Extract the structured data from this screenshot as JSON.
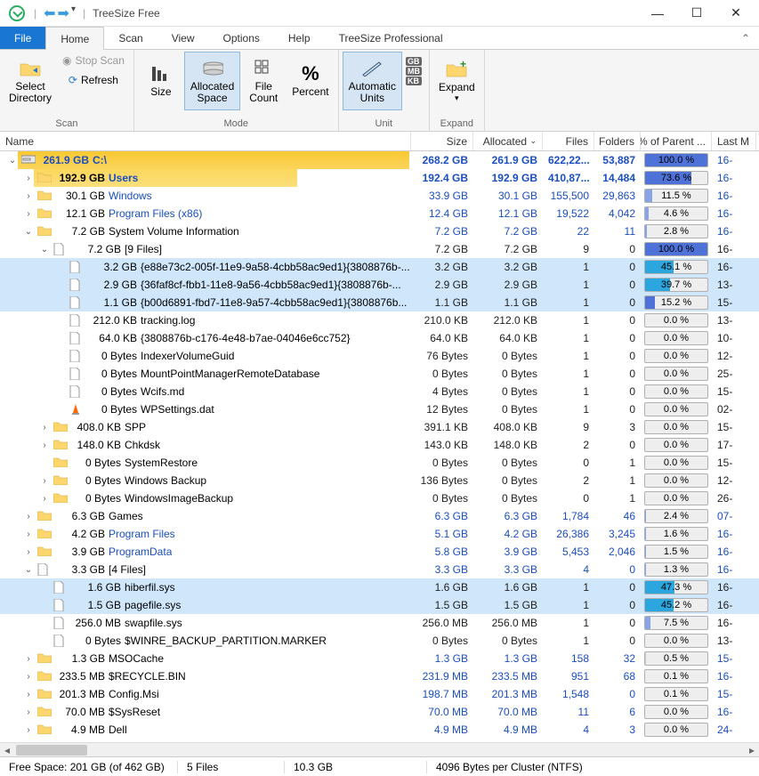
{
  "app": {
    "title": "TreeSize Free"
  },
  "tabs": {
    "file": "File",
    "home": "Home",
    "scan": "Scan",
    "view": "View",
    "options": "Options",
    "help": "Help",
    "pro": "TreeSize Professional"
  },
  "ribbon": {
    "scan": {
      "label": "Scan",
      "select_dir": "Select\nDirectory",
      "stop": "Stop Scan",
      "refresh": "Refresh"
    },
    "mode": {
      "label": "Mode",
      "size": "Size",
      "alloc": "Allocated\nSpace",
      "filecount": "File\nCount",
      "percent": "Percent"
    },
    "unit": {
      "label": "Unit",
      "auto": "Automatic\nUnits",
      "gb": "GB",
      "mb": "MB",
      "kb": "KB"
    },
    "expand": {
      "label": "Expand",
      "expand": "Expand"
    }
  },
  "columns": {
    "name": "Name",
    "size": "Size",
    "alloc": "Allocated",
    "files": "Files",
    "folders": "Folders",
    "pct": "% of Parent ...",
    "lastm": "Last M"
  },
  "widths": {
    "name": 462,
    "size": 70,
    "alloc": 78,
    "files": 58,
    "folders": 52,
    "pct": 80,
    "lastm": 50
  },
  "colors": {
    "bar_root": "#f9c932",
    "bar_users": "#fbd75b",
    "bar_blue": "#4f72d8",
    "bar_blue_light": "#8aa4e8",
    "bar_cyan": "#2ba6de"
  },
  "rows": [
    {
      "d": 0,
      "exp": "open",
      "kind": "drive",
      "sizew": 440,
      "barc": "bar_root",
      "sz": "261.9 GB",
      "nm": "C:\\",
      "link": false,
      "size": "268.2 GB",
      "alloc": "261.9 GB",
      "files": "622,22...",
      "fold": "53,887",
      "pct": "100.0 %",
      "pctw": 100,
      "pctc": "#4f72d8",
      "lm": "16-"
    },
    {
      "d": 1,
      "exp": "closed",
      "kind": "folder",
      "sizew": 296,
      "barc": "bar_users",
      "sz": "192.9 GB",
      "nm": "Users",
      "link": true,
      "bold": true,
      "size": "192.4 GB",
      "alloc": "192.9 GB",
      "files": "410,87...",
      "fold": "14,484",
      "pct": "73.6 %",
      "pctw": 74,
      "pctc": "#4f72d8",
      "lm": "16-"
    },
    {
      "d": 1,
      "exp": "closed",
      "kind": "folder",
      "sizew": 0,
      "sz": "30.1 GB",
      "nm": "Windows",
      "link": true,
      "size": "33.9 GB",
      "alloc": "30.1 GB",
      "files": "155,500",
      "fold": "29,863",
      "pct": "11.5 %",
      "pctw": 12,
      "pctc": "#8aa4e8",
      "lm": "16-"
    },
    {
      "d": 1,
      "exp": "closed",
      "kind": "folder",
      "sizew": 0,
      "sz": "12.1 GB",
      "nm": "Program Files (x86)",
      "link": true,
      "size": "12.4 GB",
      "alloc": "12.1 GB",
      "files": "19,522",
      "fold": "4,042",
      "pct": "4.6 %",
      "pctw": 5,
      "pctc": "#8aa4e8",
      "lm": "16-"
    },
    {
      "d": 1,
      "exp": "open",
      "kind": "folder",
      "sizew": 0,
      "sz": "7.2 GB",
      "nm": "System Volume Information",
      "link": false,
      "size": "7.2 GB",
      "alloc": "7.2 GB",
      "files": "22",
      "fold": "11",
      "pct": "2.8 %",
      "pctw": 3,
      "pctc": "#8aa4e8",
      "lm": "16-"
    },
    {
      "d": 2,
      "exp": "open",
      "kind": "file",
      "sizew": 0,
      "sz": "7.2 GB",
      "nm": "[9 Files]",
      "link": false,
      "size": "7.2 GB",
      "alloc": "7.2 GB",
      "files": "9",
      "fold": "0",
      "pct": "100.0 %",
      "pctw": 100,
      "pctc": "#4f72d8",
      "lm": "16-"
    },
    {
      "d": 3,
      "exp": "",
      "kind": "file",
      "sel": true,
      "sizew": 0,
      "sz": "3.2 GB",
      "nm": "{e88e73c2-005f-11e9-9a58-4cbb58ac9ed1}{3808876b-...",
      "link": false,
      "size": "3.2 GB",
      "alloc": "3.2 GB",
      "files": "1",
      "fold": "0",
      "pct": "45.1 %",
      "pctw": 45,
      "pctc": "#2ba6de",
      "lm": "16-"
    },
    {
      "d": 3,
      "exp": "",
      "kind": "file",
      "sel": true,
      "sizew": 0,
      "sz": "2.9 GB",
      "nm": "{36faf8cf-fbb1-11e8-9a56-4cbb58ac9ed1}{3808876b-...",
      "link": false,
      "size": "2.9 GB",
      "alloc": "2.9 GB",
      "files": "1",
      "fold": "0",
      "pct": "39.7 %",
      "pctw": 40,
      "pctc": "#2ba6de",
      "lm": "13-"
    },
    {
      "d": 3,
      "exp": "",
      "kind": "file",
      "sel": true,
      "sizew": 0,
      "sz": "1.1 GB",
      "nm": "{b00d6891-fbd7-11e8-9a57-4cbb58ac9ed1}{3808876b...",
      "link": false,
      "size": "1.1 GB",
      "alloc": "1.1 GB",
      "files": "1",
      "fold": "0",
      "pct": "15.2 %",
      "pctw": 15,
      "pctc": "#4f72d8",
      "lm": "15-"
    },
    {
      "d": 3,
      "exp": "",
      "kind": "file",
      "sizew": 0,
      "sz": "212.0 KB",
      "nm": "tracking.log",
      "link": false,
      "size": "210.0 KB",
      "alloc": "212.0 KB",
      "files": "1",
      "fold": "0",
      "pct": "0.0 %",
      "pctw": 0,
      "pctc": "#ccc",
      "lm": "13-"
    },
    {
      "d": 3,
      "exp": "",
      "kind": "file",
      "sizew": 0,
      "sz": "64.0 KB",
      "nm": "{3808876b-c176-4e48-b7ae-04046e6cc752}",
      "link": false,
      "size": "64.0 KB",
      "alloc": "64.0 KB",
      "files": "1",
      "fold": "0",
      "pct": "0.0 %",
      "pctw": 0,
      "pctc": "#ccc",
      "lm": "10-"
    },
    {
      "d": 3,
      "exp": "",
      "kind": "file",
      "sizew": 0,
      "sz": "0 Bytes",
      "nm": "IndexerVolumeGuid",
      "link": false,
      "size": "76 Bytes",
      "alloc": "0 Bytes",
      "files": "1",
      "fold": "0",
      "pct": "0.0 %",
      "pctw": 0,
      "pctc": "#ccc",
      "lm": "12-"
    },
    {
      "d": 3,
      "exp": "",
      "kind": "file",
      "sizew": 0,
      "sz": "0 Bytes",
      "nm": "MountPointManagerRemoteDatabase",
      "link": false,
      "size": "0 Bytes",
      "alloc": "0 Bytes",
      "files": "1",
      "fold": "0",
      "pct": "0.0 %",
      "pctw": 0,
      "pctc": "#ccc",
      "lm": "25-"
    },
    {
      "d": 3,
      "exp": "",
      "kind": "file",
      "sizew": 0,
      "sz": "0 Bytes",
      "nm": "Wcifs.md",
      "link": false,
      "size": "4 Bytes",
      "alloc": "0 Bytes",
      "files": "1",
      "fold": "0",
      "pct": "0.0 %",
      "pctw": 0,
      "pctc": "#ccc",
      "lm": "15-"
    },
    {
      "d": 3,
      "exp": "",
      "kind": "vlc",
      "sizew": 0,
      "sz": "0 Bytes",
      "nm": "WPSettings.dat",
      "link": false,
      "size": "12 Bytes",
      "alloc": "0 Bytes",
      "files": "1",
      "fold": "0",
      "pct": "0.0 %",
      "pctw": 0,
      "pctc": "#ccc",
      "lm": "02-"
    },
    {
      "d": 2,
      "exp": "closed",
      "kind": "folder",
      "sizew": 0,
      "sz": "408.0 KB",
      "nm": "SPP",
      "link": false,
      "size": "391.1 KB",
      "alloc": "408.0 KB",
      "files": "9",
      "fold": "3",
      "pct": "0.0 %",
      "pctw": 0,
      "pctc": "#ccc",
      "lm": "15-"
    },
    {
      "d": 2,
      "exp": "closed",
      "kind": "folder",
      "sizew": 0,
      "sz": "148.0 KB",
      "nm": "Chkdsk",
      "link": false,
      "size": "143.0 KB",
      "alloc": "148.0 KB",
      "files": "2",
      "fold": "0",
      "pct": "0.0 %",
      "pctw": 0,
      "pctc": "#ccc",
      "lm": "17-"
    },
    {
      "d": 2,
      "exp": "",
      "kind": "folder",
      "sizew": 0,
      "sz": "0 Bytes",
      "nm": "SystemRestore",
      "link": false,
      "size": "0 Bytes",
      "alloc": "0 Bytes",
      "files": "0",
      "fold": "1",
      "pct": "0.0 %",
      "pctw": 0,
      "pctc": "#ccc",
      "lm": "15-"
    },
    {
      "d": 2,
      "exp": "closed",
      "kind": "folder",
      "sizew": 0,
      "sz": "0 Bytes",
      "nm": "Windows Backup",
      "link": false,
      "size": "136 Bytes",
      "alloc": "0 Bytes",
      "files": "2",
      "fold": "1",
      "pct": "0.0 %",
      "pctw": 0,
      "pctc": "#ccc",
      "lm": "12-"
    },
    {
      "d": 2,
      "exp": "closed",
      "kind": "folder",
      "sizew": 0,
      "sz": "0 Bytes",
      "nm": "WindowsImageBackup",
      "link": false,
      "size": "0 Bytes",
      "alloc": "0 Bytes",
      "files": "0",
      "fold": "1",
      "pct": "0.0 %",
      "pctw": 0,
      "pctc": "#ccc",
      "lm": "26-"
    },
    {
      "d": 1,
      "exp": "closed",
      "kind": "folder",
      "sizew": 0,
      "sz": "6.3 GB",
      "nm": "Games",
      "link": false,
      "size": "6.3 GB",
      "alloc": "6.3 GB",
      "files": "1,784",
      "fold": "46",
      "pct": "2.4 %",
      "pctw": 2,
      "pctc": "#8aa4e8",
      "lm": "07-"
    },
    {
      "d": 1,
      "exp": "closed",
      "kind": "folder",
      "sizew": 0,
      "sz": "4.2 GB",
      "nm": "Program Files",
      "link": true,
      "size": "5.1 GB",
      "alloc": "4.2 GB",
      "files": "26,386",
      "fold": "3,245",
      "pct": "1.6 %",
      "pctw": 2,
      "pctc": "#8aa4e8",
      "lm": "16-"
    },
    {
      "d": 1,
      "exp": "closed",
      "kind": "folder",
      "sizew": 0,
      "sz": "3.9 GB",
      "nm": "ProgramData",
      "link": true,
      "size": "5.8 GB",
      "alloc": "3.9 GB",
      "files": "5,453",
      "fold": "2,046",
      "pct": "1.5 %",
      "pctw": 2,
      "pctc": "#8aa4e8",
      "lm": "16-"
    },
    {
      "d": 1,
      "exp": "open",
      "kind": "file",
      "sizew": 0,
      "sz": "3.3 GB",
      "nm": "[4 Files]",
      "link": false,
      "size": "3.3 GB",
      "alloc": "3.3 GB",
      "files": "4",
      "fold": "0",
      "pct": "1.3 %",
      "pctw": 1,
      "pctc": "#8aa4e8",
      "lm": "16-"
    },
    {
      "d": 2,
      "exp": "",
      "kind": "file",
      "sel": true,
      "sizew": 0,
      "sz": "1.6 GB",
      "nm": "hiberfil.sys",
      "link": false,
      "size": "1.6 GB",
      "alloc": "1.6 GB",
      "files": "1",
      "fold": "0",
      "pct": "47.3 %",
      "pctw": 47,
      "pctc": "#2ba6de",
      "lm": "16-"
    },
    {
      "d": 2,
      "exp": "",
      "kind": "file",
      "sel": true,
      "sizew": 0,
      "sz": "1.5 GB",
      "nm": "pagefile.sys",
      "link": false,
      "size": "1.5 GB",
      "alloc": "1.5 GB",
      "files": "1",
      "fold": "0",
      "pct": "45.2 %",
      "pctw": 45,
      "pctc": "#2ba6de",
      "lm": "16-"
    },
    {
      "d": 2,
      "exp": "",
      "kind": "file",
      "sizew": 0,
      "sz": "256.0 MB",
      "nm": "swapfile.sys",
      "link": false,
      "size": "256.0 MB",
      "alloc": "256.0 MB",
      "files": "1",
      "fold": "0",
      "pct": "7.5 %",
      "pctw": 8,
      "pctc": "#8aa4e8",
      "lm": "16-"
    },
    {
      "d": 2,
      "exp": "",
      "kind": "file",
      "sizew": 0,
      "sz": "0 Bytes",
      "nm": "$WINRE_BACKUP_PARTITION.MARKER",
      "link": false,
      "size": "0 Bytes",
      "alloc": "0 Bytes",
      "files": "1",
      "fold": "0",
      "pct": "0.0 %",
      "pctw": 0,
      "pctc": "#ccc",
      "lm": "13-"
    },
    {
      "d": 1,
      "exp": "closed",
      "kind": "folder",
      "sizew": 0,
      "sz": "1.3 GB",
      "nm": "MSOCache",
      "link": false,
      "size": "1.3 GB",
      "alloc": "1.3 GB",
      "files": "158",
      "fold": "32",
      "pct": "0.5 %",
      "pctw": 1,
      "pctc": "#ccc",
      "lm": "15-"
    },
    {
      "d": 1,
      "exp": "closed",
      "kind": "folder",
      "sizew": 0,
      "sz": "233.5 MB",
      "nm": "$RECYCLE.BIN",
      "link": false,
      "size": "231.9 MB",
      "alloc": "233.5 MB",
      "files": "951",
      "fold": "68",
      "pct": "0.1 %",
      "pctw": 0,
      "pctc": "#ccc",
      "lm": "16-"
    },
    {
      "d": 1,
      "exp": "closed",
      "kind": "folder",
      "sizew": 0,
      "sz": "201.3 MB",
      "nm": "Config.Msi",
      "link": false,
      "size": "198.7 MB",
      "alloc": "201.3 MB",
      "files": "1,548",
      "fold": "0",
      "pct": "0.1 %",
      "pctw": 0,
      "pctc": "#ccc",
      "lm": "15-"
    },
    {
      "d": 1,
      "exp": "closed",
      "kind": "folder",
      "sizew": 0,
      "sz": "70.0 MB",
      "nm": "$SysReset",
      "link": false,
      "size": "70.0 MB",
      "alloc": "70.0 MB",
      "files": "11",
      "fold": "6",
      "pct": "0.0 %",
      "pctw": 0,
      "pctc": "#ccc",
      "lm": "16-"
    },
    {
      "d": 1,
      "exp": "closed",
      "kind": "folder",
      "sizew": 0,
      "sz": "4.9 MB",
      "nm": "Dell",
      "link": false,
      "size": "4.9 MB",
      "alloc": "4.9 MB",
      "files": "4",
      "fold": "3",
      "pct": "0.0 %",
      "pctw": 0,
      "pctc": "#ccc",
      "lm": "24-"
    }
  ],
  "status": {
    "free": "Free Space: 201 GB  (of 462 GB)",
    "files": "5  Files",
    "size": "10.3 GB",
    "cluster": "4096  Bytes per Cluster (NTFS)"
  }
}
